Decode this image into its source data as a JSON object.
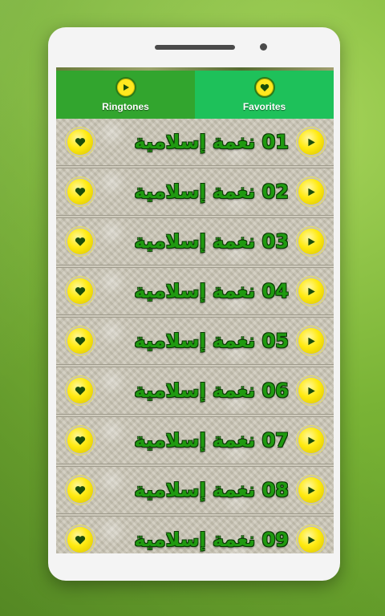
{
  "tabs": [
    {
      "label": "Ringtones",
      "icon": "play-icon",
      "active": true
    },
    {
      "label": "Favorites",
      "icon": "heart-icon",
      "active": false
    }
  ],
  "ringtones": [
    {
      "title": "01 نغمة إسلامية"
    },
    {
      "title": "02 نغمة إسلامية"
    },
    {
      "title": "03 نغمة إسلامية"
    },
    {
      "title": "04 نغمة إسلامية"
    },
    {
      "title": "05 نغمة إسلامية"
    },
    {
      "title": "06 نغمة إسلامية"
    },
    {
      "title": "07 نغمة إسلامية"
    },
    {
      "title": "08 نغمة إسلامية"
    },
    {
      "title": "09 نغمة إسلامية"
    }
  ],
  "colors": {
    "tab_ringtones": "#32a52e",
    "tab_favorites": "#1ec15a",
    "button_yellow": "#ffea10",
    "title_green": "#1f9a10"
  }
}
